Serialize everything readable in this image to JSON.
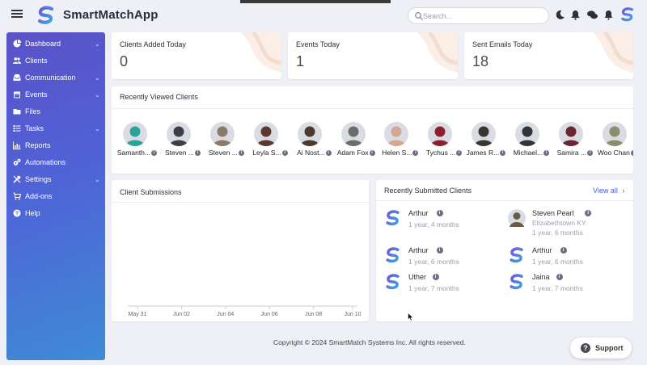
{
  "app": {
    "name": "SmartMatchApp"
  },
  "header": {
    "search_placeholder": "Search...",
    "icons": [
      "moon-icon",
      "notification-bell-outline-icon",
      "chat-icon",
      "bell-icon",
      "avatar-logo"
    ]
  },
  "sidebar": {
    "items": [
      {
        "label": "Dashboard",
        "icon": "pie-chart-icon",
        "chevron": "⌄"
      },
      {
        "label": "Clients",
        "icon": "users-icon",
        "chevron": ""
      },
      {
        "label": "Communication",
        "icon": "inbox-icon",
        "chevron": "⌄"
      },
      {
        "label": "Events",
        "icon": "calendar-icon",
        "chevron": "⌄"
      },
      {
        "label": "Files",
        "icon": "folder-icon",
        "chevron": ""
      },
      {
        "label": "Tasks",
        "icon": "task-list-icon",
        "chevron": "⌄"
      },
      {
        "label": "Reports",
        "icon": "bar-chart-icon",
        "chevron": ""
      },
      {
        "label": "Automations",
        "icon": "cogs-icon",
        "chevron": ""
      },
      {
        "label": "Settings",
        "icon": "tools-icon",
        "chevron": "⌄"
      },
      {
        "label": "Add-ons",
        "icon": "cart-icon",
        "chevron": ""
      },
      {
        "label": "Help",
        "icon": "question-icon",
        "chevron": ""
      }
    ]
  },
  "stats": [
    {
      "title": "Clients Added Today",
      "value": "0"
    },
    {
      "title": "Events Today",
      "value": "1"
    },
    {
      "title": "Sent Emails Today",
      "value": "18"
    }
  ],
  "recently_viewed": {
    "title": "Recently Viewed Clients",
    "clients": [
      {
        "name": "Samanth...",
        "tone": "#2aa39a"
      },
      {
        "name": "Steven ...",
        "tone": "#3a3f4a"
      },
      {
        "name": "Steven ...",
        "tone": "#8a7a6a"
      },
      {
        "name": "Leyla S...",
        "tone": "#5a3a2e"
      },
      {
        "name": "Ai Nost...",
        "tone": "#4a3a30"
      },
      {
        "name": "Adam Fox",
        "tone": "#6c6c6c"
      },
      {
        "name": "Helen S...",
        "tone": "#d4a890"
      },
      {
        "name": "Tychus ...",
        "tone": "#8b2030"
      },
      {
        "name": "James R...",
        "tone": "#3b3530"
      },
      {
        "name": "Michael...",
        "tone": "#2f3438"
      },
      {
        "name": "Samira ...",
        "tone": "#6a2530"
      },
      {
        "name": "Woo Chan",
        "tone": "#8a8e6a"
      }
    ]
  },
  "submissions": {
    "title": "Client Submissions",
    "chart_data": {
      "type": "line",
      "x": [
        "May 31",
        "Jun 02",
        "Jun 04",
        "Jun 06",
        "Jun 08",
        "Jun 10"
      ],
      "series": [],
      "title": "Client Submissions",
      "xlabel": "",
      "ylabel": "",
      "grid": false
    }
  },
  "recent_submitted": {
    "title": "Recently Submitted Clients",
    "view_all": "View all",
    "left": [
      {
        "name": "Arthur",
        "sub": "1 year, 4 months",
        "extra": ""
      },
      {
        "name": "Arthur",
        "sub": "1 year, 6 months",
        "extra": ""
      },
      {
        "name": "Uther",
        "sub": "1 year, 7 months",
        "extra": ""
      }
    ],
    "right": [
      {
        "name": "Steven Pearl",
        "sub": "1 year, 6 months",
        "extra": "Elizabethtown KY"
      },
      {
        "name": "Arthur",
        "sub": "1 year, 6 months",
        "extra": ""
      },
      {
        "name": "Jaina",
        "sub": "1 year, 7 months",
        "extra": ""
      }
    ]
  },
  "footer": {
    "copyright": "Copyright © 2024 SmartMatch Systems Inc. All rights reserved.",
    "support_label": "Support"
  },
  "colors": {
    "accent": "#4f63d6",
    "sidebar_top": "#5b52c8",
    "sidebar_bottom": "#3f8bd6",
    "link": "#4a5fd0"
  }
}
